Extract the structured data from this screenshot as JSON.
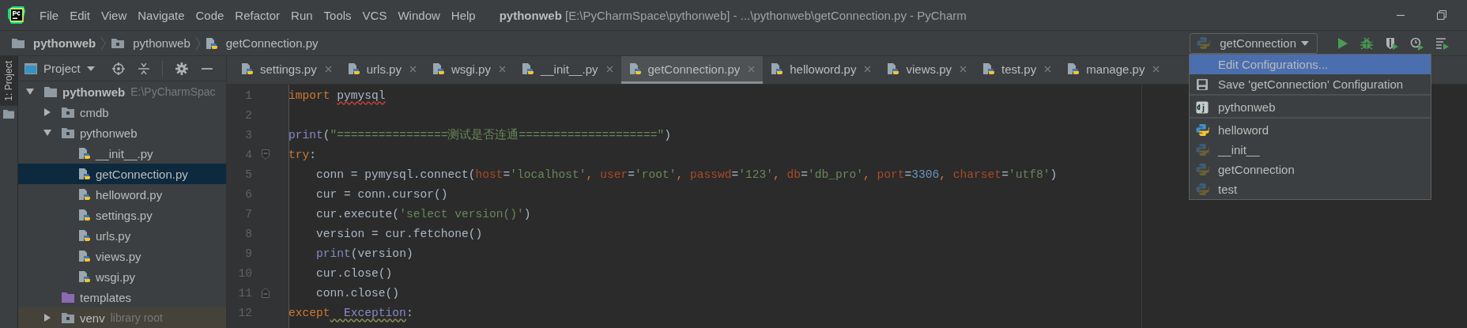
{
  "menu_bar": [
    {
      "label": "File"
    },
    {
      "label": "Edit"
    },
    {
      "label": "View"
    },
    {
      "label": "Navigate"
    },
    {
      "label": "Code"
    },
    {
      "label": "Refactor"
    },
    {
      "label": "Run"
    },
    {
      "label": "Tools"
    },
    {
      "label": "VCS"
    },
    {
      "label": "Window"
    },
    {
      "label": "Help"
    }
  ],
  "window": {
    "title": "**pythonweb** [E:\\PyCharmSpace\\pythonweb] - ...\\pythonweb\\getConnection.py - PyCharm"
  },
  "breadcrumbs": [
    {
      "label": "pythonweb",
      "kind": "project"
    },
    {
      "label": "pythonweb",
      "kind": "folder"
    },
    {
      "label": "getConnection.py",
      "kind": "file"
    }
  ],
  "run_configuration": {
    "label": "getConnection"
  },
  "side_tab": {
    "label": "1: Project",
    "selected": true
  },
  "project_panel": {
    "title": "Project"
  },
  "tree": [
    {
      "label": "pythonweb",
      "path": "E:\\PyCharmSpac",
      "kind": "project",
      "expanded": true,
      "selected": false,
      "children": [
        {
          "label": "cmdb",
          "kind": "package",
          "expanded": false,
          "selected": false
        },
        {
          "label": "pythonweb",
          "kind": "package",
          "expanded": true,
          "selected": false,
          "children": [
            {
              "label": "__init__.py",
              "kind": "python",
              "selected": false
            },
            {
              "label": "getConnection.py",
              "kind": "python",
              "selected": true
            },
            {
              "label": "helloword.py",
              "kind": "python",
              "selected": false
            },
            {
              "label": "settings.py",
              "kind": "python",
              "selected": false
            },
            {
              "label": "urls.py",
              "kind": "python",
              "selected": false
            },
            {
              "label": "views.py",
              "kind": "python",
              "selected": false
            },
            {
              "label": "wsgi.py",
              "kind": "python",
              "selected": false
            }
          ]
        },
        {
          "label": "templates",
          "kind": "templates",
          "selected": false
        },
        {
          "label": "venv",
          "path": "library root",
          "kind": "library",
          "expanded": false,
          "selected": false
        }
      ]
    }
  ],
  "tabs": [
    {
      "label": "settings.py",
      "selected": false
    },
    {
      "label": "urls.py",
      "selected": false
    },
    {
      "label": "wsgi.py",
      "selected": false
    },
    {
      "label": "__init__.py",
      "selected": false
    },
    {
      "label": "getConnection.py",
      "selected": true
    },
    {
      "label": "helloword.py",
      "selected": false
    },
    {
      "label": "views.py",
      "selected": false
    },
    {
      "label": "test.py",
      "selected": false
    },
    {
      "label": "manage.py",
      "selected": false
    }
  ],
  "code": [
    {
      "number": "1",
      "tokens": [
        {
          "kind": "keyword",
          "text": "import "
        },
        {
          "kind": "plain",
          "text": "pymysql",
          "error": true
        }
      ]
    },
    {
      "number": "2"
    },
    {
      "number": "3",
      "tokens": [
        {
          "kind": "builtin",
          "text": "print"
        },
        {
          "kind": "plain",
          "text": "("
        },
        {
          "kind": "string",
          "text": "\"================测试是否连通====================\""
        },
        {
          "kind": "plain",
          "text": ")"
        }
      ]
    },
    {
      "number": "4",
      "fold_start": true,
      "tokens": [
        {
          "kind": "keyword",
          "text": "try"
        },
        {
          "kind": "plain",
          "text": ":"
        }
      ]
    },
    {
      "number": "5",
      "tokens": [
        {
          "kind": "plain",
          "text": "    conn = pymysql.connect("
        },
        {
          "kind": "param",
          "text": "host"
        },
        {
          "kind": "plain",
          "text": "="
        },
        {
          "kind": "string",
          "text": "'localhost'"
        },
        {
          "kind": "keyword",
          "text": ", "
        },
        {
          "kind": "param",
          "text": "user"
        },
        {
          "kind": "plain",
          "text": "="
        },
        {
          "kind": "string",
          "text": "'root'"
        },
        {
          "kind": "keyword",
          "text": ", "
        },
        {
          "kind": "param",
          "text": "passwd"
        },
        {
          "kind": "plain",
          "text": "="
        },
        {
          "kind": "string",
          "text": "'123'"
        },
        {
          "kind": "keyword",
          "text": ", "
        },
        {
          "kind": "param",
          "text": "db"
        },
        {
          "kind": "plain",
          "text": "="
        },
        {
          "kind": "string",
          "text": "'db_pro'"
        },
        {
          "kind": "keyword",
          "text": ", "
        },
        {
          "kind": "param",
          "text": "port"
        },
        {
          "kind": "plain",
          "text": "="
        },
        {
          "kind": "number",
          "text": "3306"
        },
        {
          "kind": "keyword",
          "text": ", "
        },
        {
          "kind": "param",
          "text": "charset"
        },
        {
          "kind": "plain",
          "text": "="
        },
        {
          "kind": "string",
          "text": "'utf8'"
        },
        {
          "kind": "plain",
          "text": ")"
        }
      ]
    },
    {
      "number": "6",
      "tokens": [
        {
          "kind": "plain",
          "text": "    cur = conn.cursor()"
        }
      ]
    },
    {
      "number": "7",
      "tokens": [
        {
          "kind": "plain",
          "text": "    cur.execute("
        },
        {
          "kind": "string",
          "text": "'select version()'"
        },
        {
          "kind": "plain",
          "text": ")"
        }
      ]
    },
    {
      "number": "8",
      "tokens": [
        {
          "kind": "plain",
          "text": "    version = cur.fetchone()"
        }
      ]
    },
    {
      "number": "9",
      "tokens": [
        {
          "kind": "builtin",
          "text": "    print"
        },
        {
          "kind": "plain",
          "text": "(version)"
        }
      ]
    },
    {
      "number": "10",
      "tokens": [
        {
          "kind": "plain",
          "text": "    cur.close()"
        }
      ]
    },
    {
      "number": "11",
      "fold_end": true,
      "tokens": [
        {
          "kind": "plain",
          "text": "    conn.close()"
        }
      ]
    },
    {
      "number": "12",
      "tokens": [
        {
          "kind": "keyword",
          "text": "except"
        },
        {
          "kind": "builtin",
          "text": "  Exception",
          "warning": true
        },
        {
          "kind": "plain",
          "text": ":"
        }
      ]
    }
  ],
  "config_menu": {
    "groups": [
      {
        "items": [
          {
            "label": "Edit Configurations...",
            "kind": "action",
            "selected": true
          },
          {
            "label": "Save 'getConnection' Configuration",
            "kind": "save",
            "selected": false
          }
        ]
      },
      {
        "items": [
          {
            "label": "pythonweb",
            "kind": "django",
            "selected": false
          }
        ]
      },
      {
        "items": [
          {
            "label": "helloword",
            "kind": "python",
            "temporary": false,
            "selected": false
          },
          {
            "label": "__init__",
            "kind": "python",
            "temporary": true,
            "selected": false
          },
          {
            "label": "getConnection",
            "kind": "python",
            "temporary": true,
            "selected": false
          },
          {
            "label": "test",
            "kind": "python",
            "temporary": true,
            "selected": false
          }
        ]
      }
    ]
  }
}
